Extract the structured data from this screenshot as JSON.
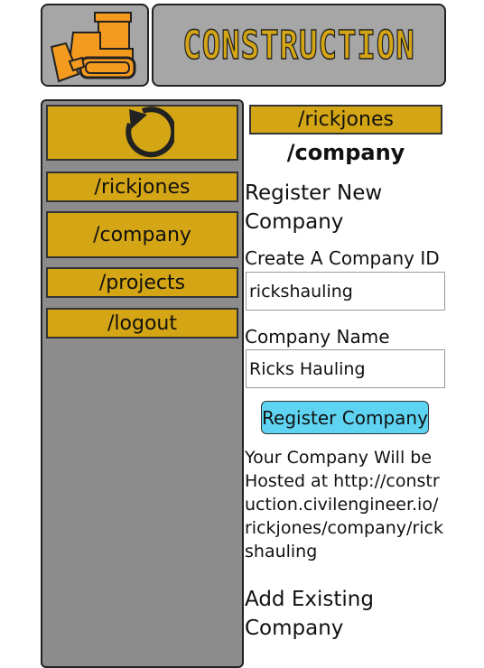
{
  "header": {
    "title": "CONSTRUCTION",
    "logo_icon": "bulldozer-icon"
  },
  "sidebar": {
    "refresh_icon": "refresh-icon",
    "items": [
      {
        "label": "/rickjones"
      },
      {
        "label": "/company"
      },
      {
        "label": "/projects"
      },
      {
        "label": "/logout"
      }
    ]
  },
  "main": {
    "user_path": "/rickjones",
    "page_title": "/company",
    "register_heading": "Register New Company",
    "company_id_label": "Create A Company ID",
    "company_id_value": "rickshauling",
    "company_name_label": "Company Name",
    "company_name_value": "Ricks Hauling",
    "register_button": "Register Company",
    "hosted_text": "Your Company Will be Hosted at http://construction.civilengineer.io/rickjones/company/rickshauling",
    "add_existing_heading": "Add Existing Company"
  },
  "colors": {
    "accent_gold": "#d4a514",
    "panel_gray": "#8c8c8c",
    "header_gray": "#a6a6a6",
    "button_cyan": "#5fd4f2",
    "bulldozer_orange": "#f39a1f"
  }
}
